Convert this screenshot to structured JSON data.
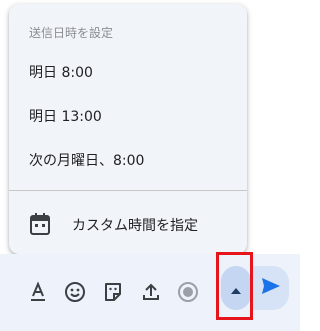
{
  "schedule_menu": {
    "header": "送信日時を設定",
    "options": [
      {
        "label": "明日 8:00"
      },
      {
        "label": "明日 13:00"
      },
      {
        "label": "次の月曜日、8:00"
      }
    ],
    "custom": {
      "label": "カスタム時間を指定",
      "icon": "calendar-icon"
    }
  },
  "toolbar": {
    "icons": [
      "text-format-icon",
      "emoji-icon",
      "sticker-icon",
      "upload-icon",
      "record-icon"
    ],
    "schedule_toggle_icon": "caret-up-icon",
    "send_icon": "send-icon"
  },
  "colors": {
    "accent": "#1a73e8",
    "highlight": "#e6151c",
    "toggle_bg": "#c4d6f2",
    "bar_bg": "#eef3fb"
  }
}
